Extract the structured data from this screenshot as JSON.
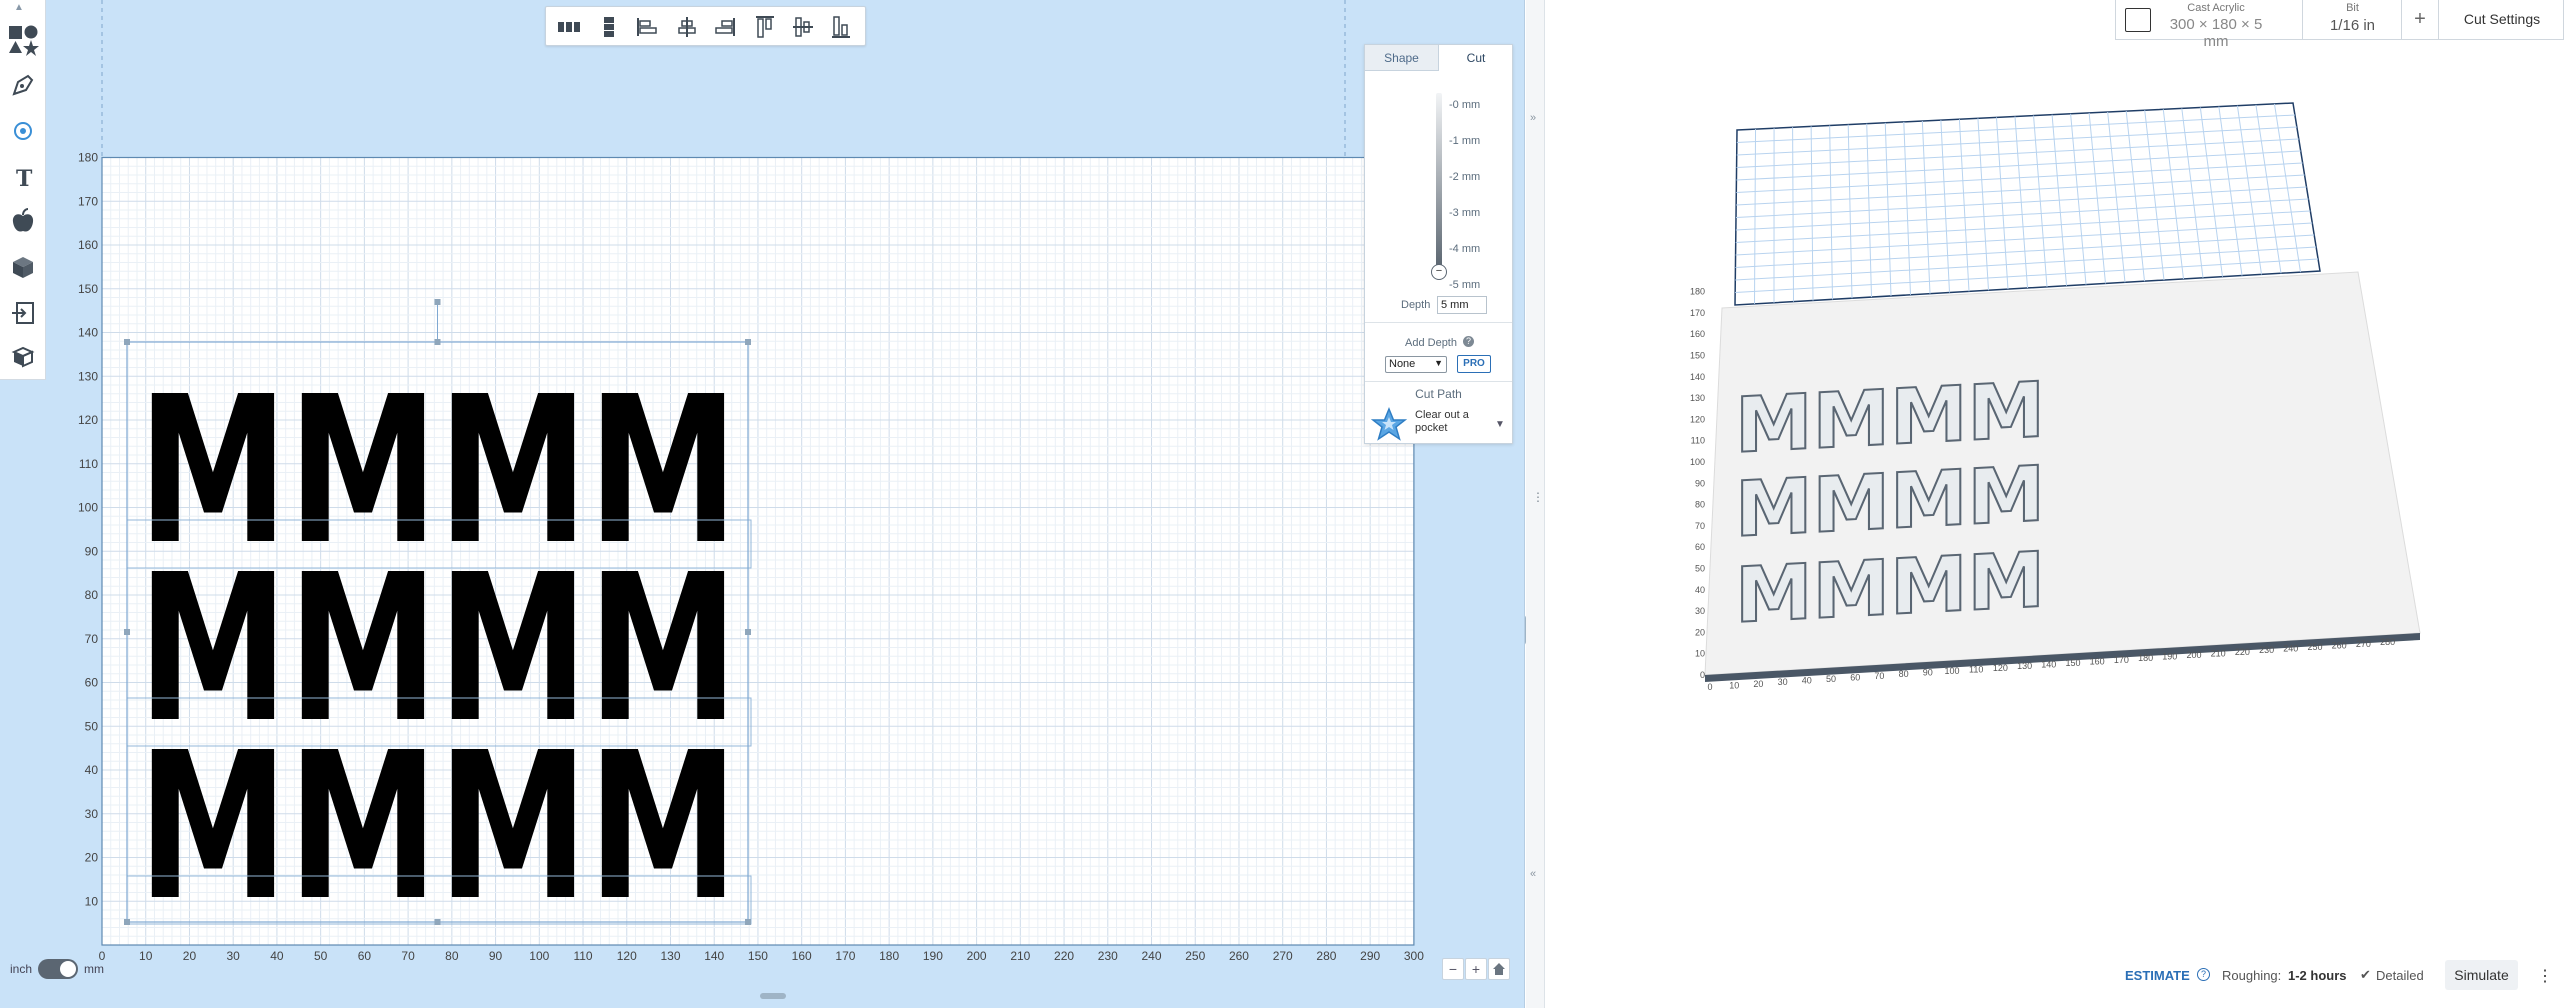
{
  "material": {
    "name": "Cast Acrylic",
    "size": "300 × 180 × 5 mm",
    "bit_label": "Bit",
    "bit_value": "1/16 in",
    "add_label": "+",
    "cut_settings": "Cut Settings"
  },
  "tabs": {
    "shape": "Shape",
    "cut": "Cut"
  },
  "depth_scale": [
    "-0 mm",
    "-1 mm",
    "-2 mm",
    "-3 mm",
    "-4 mm",
    "-5 mm"
  ],
  "depth": {
    "label": "Depth",
    "value": "5 mm"
  },
  "add_depth": {
    "label": "Add Depth",
    "help": "?",
    "select_value": "None",
    "pro": "PRO"
  },
  "cut_path": {
    "label": "Cut Path",
    "option": "Clear out a pocket"
  },
  "design": {
    "text_rows": [
      "MMMM",
      "MMMM",
      "MMMM"
    ],
    "y_ticks": [
      "180",
      "170",
      "160",
      "150",
      "140",
      "130",
      "120",
      "110",
      "100",
      "90",
      "80",
      "70",
      "60",
      "50",
      "40",
      "30",
      "20",
      "10"
    ],
    "x_ticks": [
      "0",
      "10",
      "20",
      "30",
      "40",
      "50",
      "60",
      "70",
      "80",
      "90",
      "100",
      "110",
      "120",
      "130",
      "140",
      "150",
      "160",
      "170",
      "180",
      "190",
      "200",
      "210",
      "220",
      "230",
      "240",
      "250",
      "260",
      "270",
      "280",
      "290",
      "300"
    ]
  },
  "preview": {
    "x_ticks": [
      "0",
      "10",
      "20",
      "30",
      "40",
      "50",
      "60",
      "70",
      "80",
      "90",
      "100",
      "110",
      "120",
      "130",
      "140",
      "150",
      "160",
      "170",
      "180",
      "190",
      "200",
      "210",
      "220",
      "230",
      "240",
      "250",
      "260",
      "270",
      "280"
    ],
    "y_ticks": [
      "0",
      "10",
      "20",
      "30",
      "40",
      "50",
      "60",
      "70",
      "80",
      "90",
      "100",
      "110",
      "120",
      "130",
      "140",
      "150",
      "160",
      "170",
      "180"
    ]
  },
  "units": {
    "left": "inch",
    "right": "mm"
  },
  "estimate": {
    "label": "ESTIMATE",
    "roughing_label": "Roughing:",
    "roughing_value": "1-2 hours",
    "detailed": "Detailed",
    "simulate": "Simulate",
    "more": "⋮"
  },
  "zoom": {
    "minus": "−",
    "plus": "+"
  }
}
